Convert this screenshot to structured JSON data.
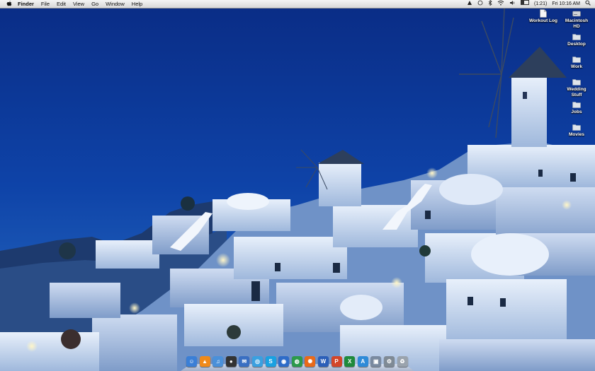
{
  "menubar": {
    "apple_icon": "apple-logo-icon",
    "app_name": "Finder",
    "menus": [
      "File",
      "Edit",
      "View",
      "Go",
      "Window",
      "Help"
    ],
    "status": {
      "battery_time": "(1:21)",
      "clock": "Fri 10:16 AM",
      "battery_level": 0.4
    }
  },
  "desktop": {
    "icons": [
      {
        "label": "Workout Log",
        "icon": "document-icon"
      },
      {
        "label": "Macintosh HD",
        "icon": "hard-drive-icon"
      },
      {
        "label": "Desktop",
        "icon": "folder-icon"
      },
      {
        "label": "Work",
        "icon": "folder-icon"
      },
      {
        "label": "Wedding Stuff",
        "icon": "folder-icon"
      },
      {
        "label": "Jobs",
        "icon": "folder-icon"
      },
      {
        "label": "Movies",
        "icon": "folder-icon"
      }
    ]
  },
  "dock": {
    "items": [
      {
        "name": "finder",
        "color": "#3b7fd6"
      },
      {
        "name": "vlc",
        "color": "#f08a1a"
      },
      {
        "name": "itunes",
        "color": "#4a90d9"
      },
      {
        "name": "camera",
        "color": "#333333"
      },
      {
        "name": "mail",
        "color": "#3a6fc2"
      },
      {
        "name": "safari",
        "color": "#3aa0e0"
      },
      {
        "name": "skype",
        "color": "#1aa1e1"
      },
      {
        "name": "system",
        "color": "#2e6cc8"
      },
      {
        "name": "chrome",
        "color": "#2c9a4b"
      },
      {
        "name": "firefox",
        "color": "#e86a1a"
      },
      {
        "name": "word",
        "color": "#2b5fb8"
      },
      {
        "name": "powerpoint",
        "color": "#d2462a"
      },
      {
        "name": "excel",
        "color": "#1f8a3c"
      },
      {
        "name": "appstore",
        "color": "#2f8bd8"
      },
      {
        "name": "preview",
        "color": "#7a8aa0"
      },
      {
        "name": "utility",
        "color": "#7f8a95"
      },
      {
        "name": "trash",
        "color": "#9aa3ad"
      }
    ]
  }
}
